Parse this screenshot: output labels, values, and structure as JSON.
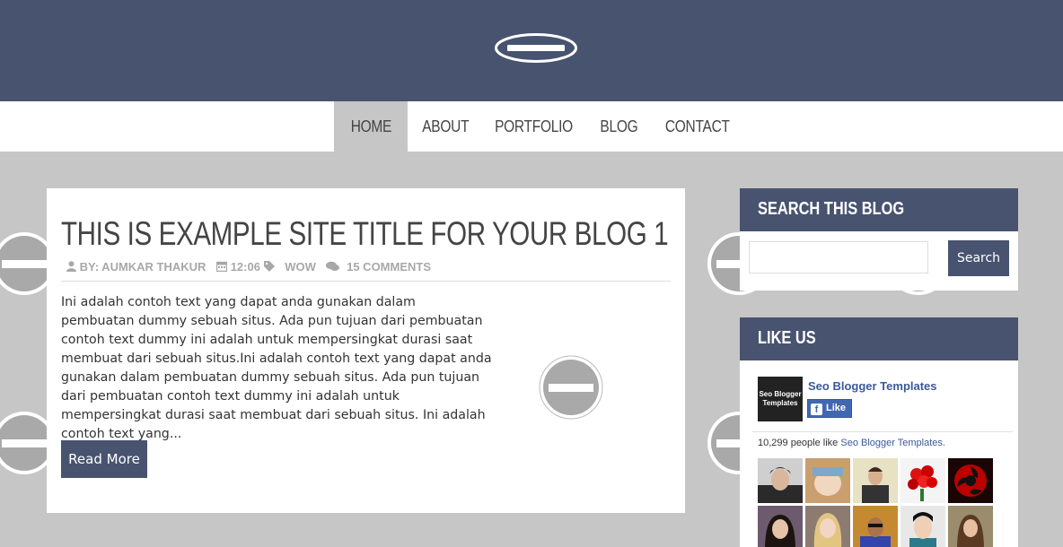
{
  "nav": {
    "items": [
      {
        "label": "HOME",
        "active": true
      },
      {
        "label": "ABOUT",
        "active": false
      },
      {
        "label": "PORTFOLIO",
        "active": false
      },
      {
        "label": "BLOG",
        "active": false
      },
      {
        "label": "CONTACT",
        "active": false
      }
    ]
  },
  "post": {
    "title": "THIS IS EXAMPLE SITE TITLE FOR YOUR BLOG 1",
    "author": "BY: AUMKAR THAKUR",
    "time": "12:06",
    "label": "WOW",
    "comments": "15 COMMENTS",
    "excerpt": "Ini adalah contoh text yang dapat anda gunakan dalam pembuatan dummy sebuah situs. Ada pun tujuan dari pembuatan contoh text dummy ini adalah untuk mempersingkat durasi saat membuat dari sebuah situs.Ini adalah contoh text yang dapat anda gunakan dalam pembuatan dummy sebuah situs. Ada pun tujuan dari pembuatan contoh text dummy ini adalah untuk mempersingkat durasi saat membuat dari sebuah situs. Ini adalah contoh text yang...",
    "read_more": "Read More"
  },
  "search_widget": {
    "title": "SEARCH THIS BLOG",
    "placeholder": "",
    "button": "Search"
  },
  "like_widget": {
    "title": "LIKE US",
    "page_logo_text": "Seo Blogger Templates",
    "page_name": "Seo Blogger Templates",
    "like_button": "Like",
    "count_prefix": "10,299 people like",
    "count_link": "Seo Blogger Templates."
  },
  "colors": {
    "header": "#48536f",
    "background": "#c6c6c6",
    "accent": "#48536f",
    "facebook": "#3b5998"
  },
  "icons": [
    "user-icon",
    "calendar-icon",
    "tag-icon",
    "comments-icon",
    "blocked-image-icon",
    "facebook-icon"
  ]
}
